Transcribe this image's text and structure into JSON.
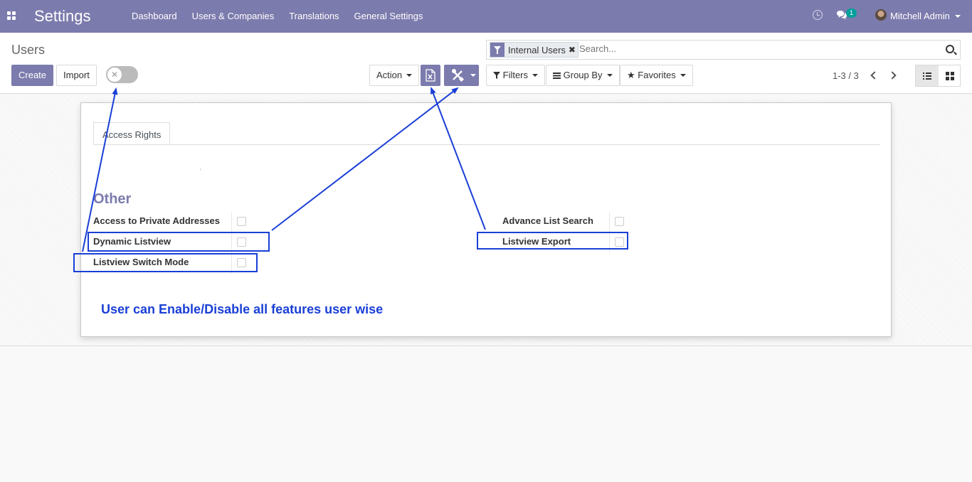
{
  "navbar": {
    "app_title": "Settings",
    "menu": [
      "Dashboard",
      "Users & Companies",
      "Translations",
      "General Settings"
    ],
    "chat_badge": "1",
    "user_name": "Mitchell Admin"
  },
  "control_panel": {
    "breadcrumb": "Users",
    "create_label": "Create",
    "import_label": "Import",
    "action_label": "Action",
    "search_facet": "Internal Users",
    "search_placeholder": "Search...",
    "filters_label": "Filters",
    "group_by_label": "Group By",
    "favorites_label": "Favorites",
    "pager": "1-3 / 3"
  },
  "form": {
    "tab_label": "Access Rights",
    "group_title": "Other",
    "left_fields": [
      {
        "label": "Access to Private Addresses",
        "checked": false
      },
      {
        "label": "Dynamic Listview",
        "checked": false
      },
      {
        "label": "Listview Switch Mode",
        "checked": false
      }
    ],
    "right_fields": [
      {
        "label": "Advance List Search",
        "checked": false
      },
      {
        "label": "Listview Export",
        "checked": false
      }
    ]
  },
  "annotation": {
    "text": "User can Enable/Disable all features user wise",
    "color": "#1a3fd6"
  },
  "colors": {
    "brand": "#7c7bad",
    "annotation": "#1a3fd6"
  },
  "icons": [
    "apps-icon",
    "clock-icon",
    "chat-icon",
    "avatar",
    "filter-icon",
    "close-icon",
    "search-icon",
    "excel-export-icon",
    "tools-icon",
    "chevron-left-icon",
    "chevron-right-icon",
    "list-view-icon",
    "kanban-view-icon",
    "star-icon",
    "hamburger-icon"
  ]
}
